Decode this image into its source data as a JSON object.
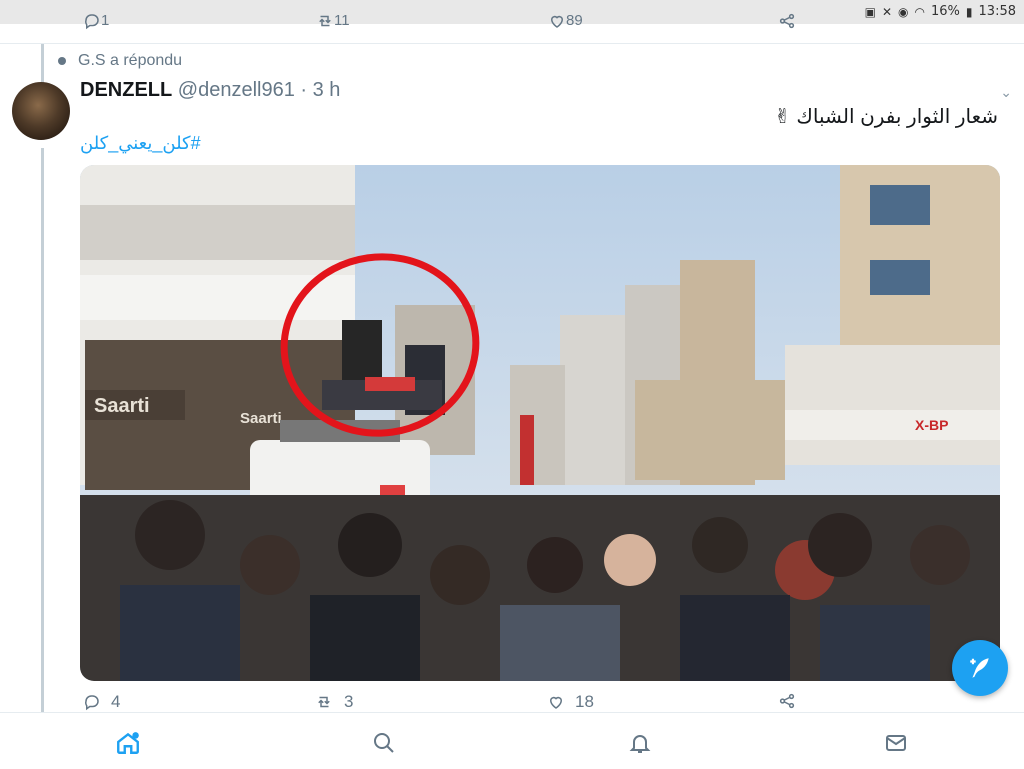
{
  "status_bar": {
    "battery": "16%",
    "time": "13:58"
  },
  "previous_tweet": {
    "replies": "1",
    "retweets": "11",
    "likes": "89"
  },
  "reply_context": "G.S a répondu",
  "tweet": {
    "author_name": "DENZELL",
    "author_handle": "@denzell961",
    "time_ago": "· 3 h",
    "text": "شعار الثوار بفرن الشباك ✌",
    "hashtag": "#كلن_يعني_كلن",
    "replies": "4",
    "retweets": "3",
    "likes": "18"
  },
  "photo": {
    "shop_sign_1": "Saarti",
    "shop_sign_2": "Saarti",
    "shop_sign_3": "X-BP"
  },
  "colors": {
    "accent": "#1da1f2",
    "circle": "#e3141b"
  },
  "nav": [
    "home-icon",
    "search-icon",
    "notifications-icon",
    "messages-icon"
  ]
}
